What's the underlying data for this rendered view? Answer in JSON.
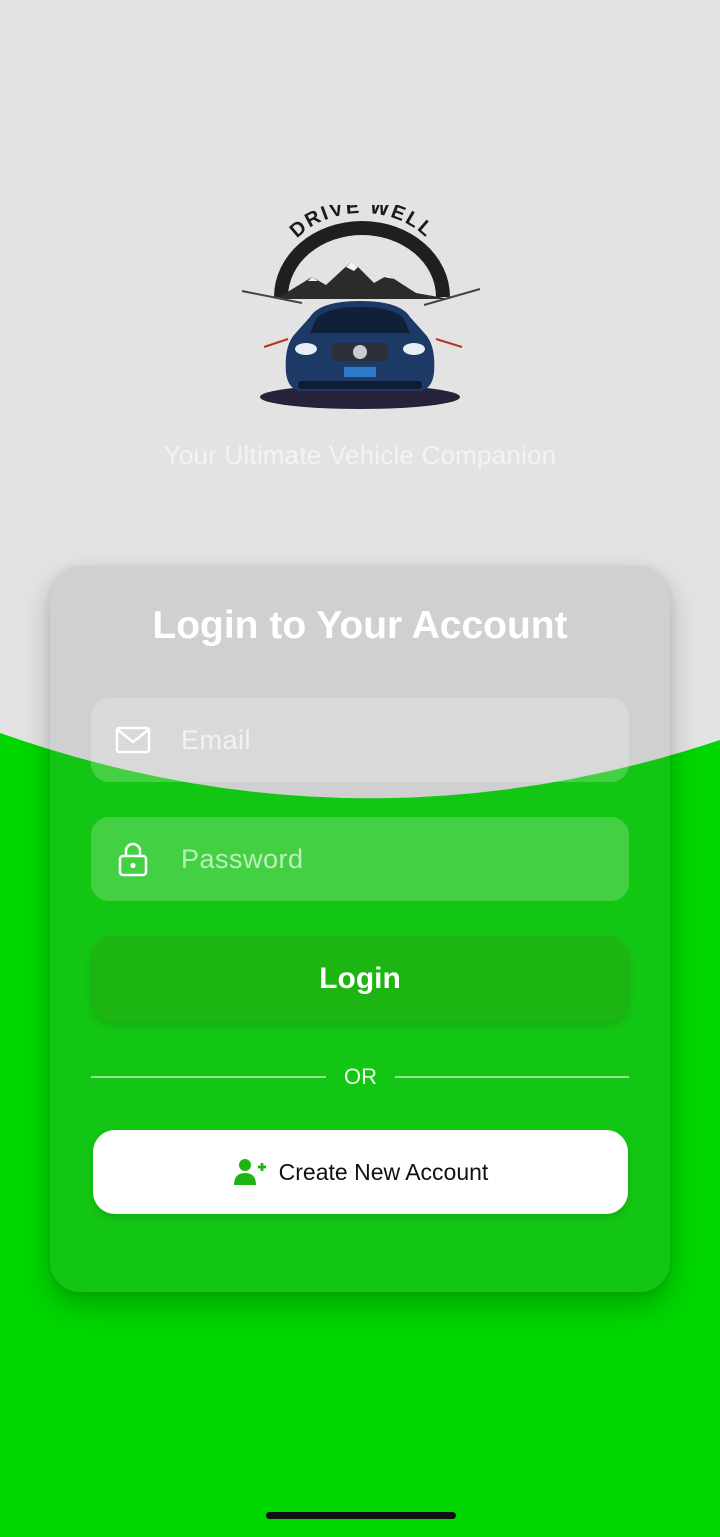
{
  "app": {
    "logo_text": "DRIVE WELL",
    "tagline": "Your Ultimate Vehicle Companion"
  },
  "login_card": {
    "title": "Login to Your Account",
    "email": {
      "placeholder": "Email",
      "value": "",
      "icon": "mail-icon"
    },
    "password": {
      "placeholder": "Password",
      "value": "",
      "icon": "lock-icon"
    },
    "login_button": "Login",
    "divider_text": "OR",
    "create_account": {
      "label": "Create New Account",
      "icon": "add-user-icon"
    }
  },
  "colors": {
    "background_top": "#e3e3e3",
    "background_bottom": "#00d600",
    "login_button": "#1db511",
    "create_button": "#ffffff"
  }
}
